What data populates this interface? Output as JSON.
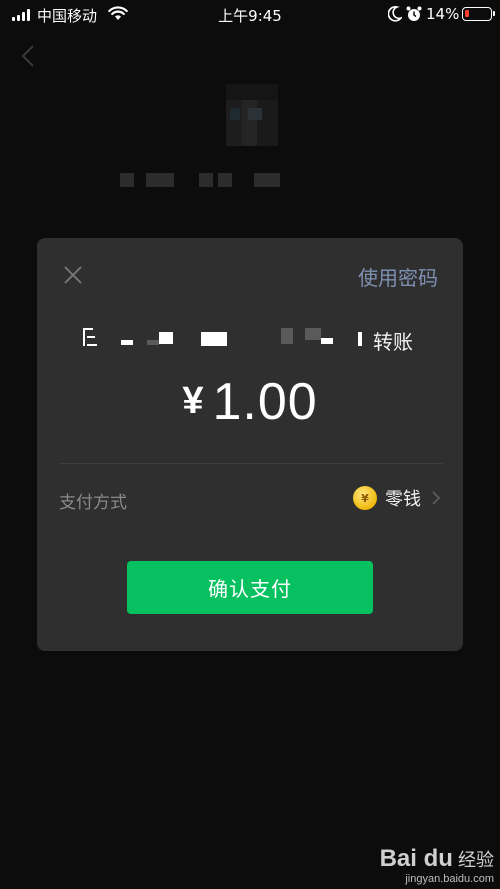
{
  "status_bar": {
    "carrier": "中国移动",
    "time": "上午9:45",
    "battery": "14%",
    "battery_level": 0.14,
    "icons": [
      "signal-icon",
      "wifi-icon",
      "moon-icon",
      "alarm-icon",
      "battery-icon"
    ]
  },
  "background_page": {
    "payee_name_fragment": " ",
    "back_icon": "chevron-left-icon"
  },
  "dialog": {
    "close_icon": "close-icon",
    "use_password": "使用密码",
    "transfer_prefix": "向",
    "transfer_suffix": "转账",
    "amount_currency": "¥",
    "amount_value": "1.00",
    "payment_method_label": "支付方式",
    "payment_method_value": "零钱",
    "payment_method_icon": "coin-icon",
    "confirm_button": "确认支付"
  },
  "watermark": {
    "brand": "Bai du",
    "brand_suffix": "经验",
    "url": "jingyan.baidu.com"
  },
  "colors": {
    "background": "#0c0c0c",
    "dialog": "#2f2f2f",
    "accent_link": "#7e90b1",
    "confirm_green": "#07c160",
    "battery_low": "#ff3b30"
  }
}
